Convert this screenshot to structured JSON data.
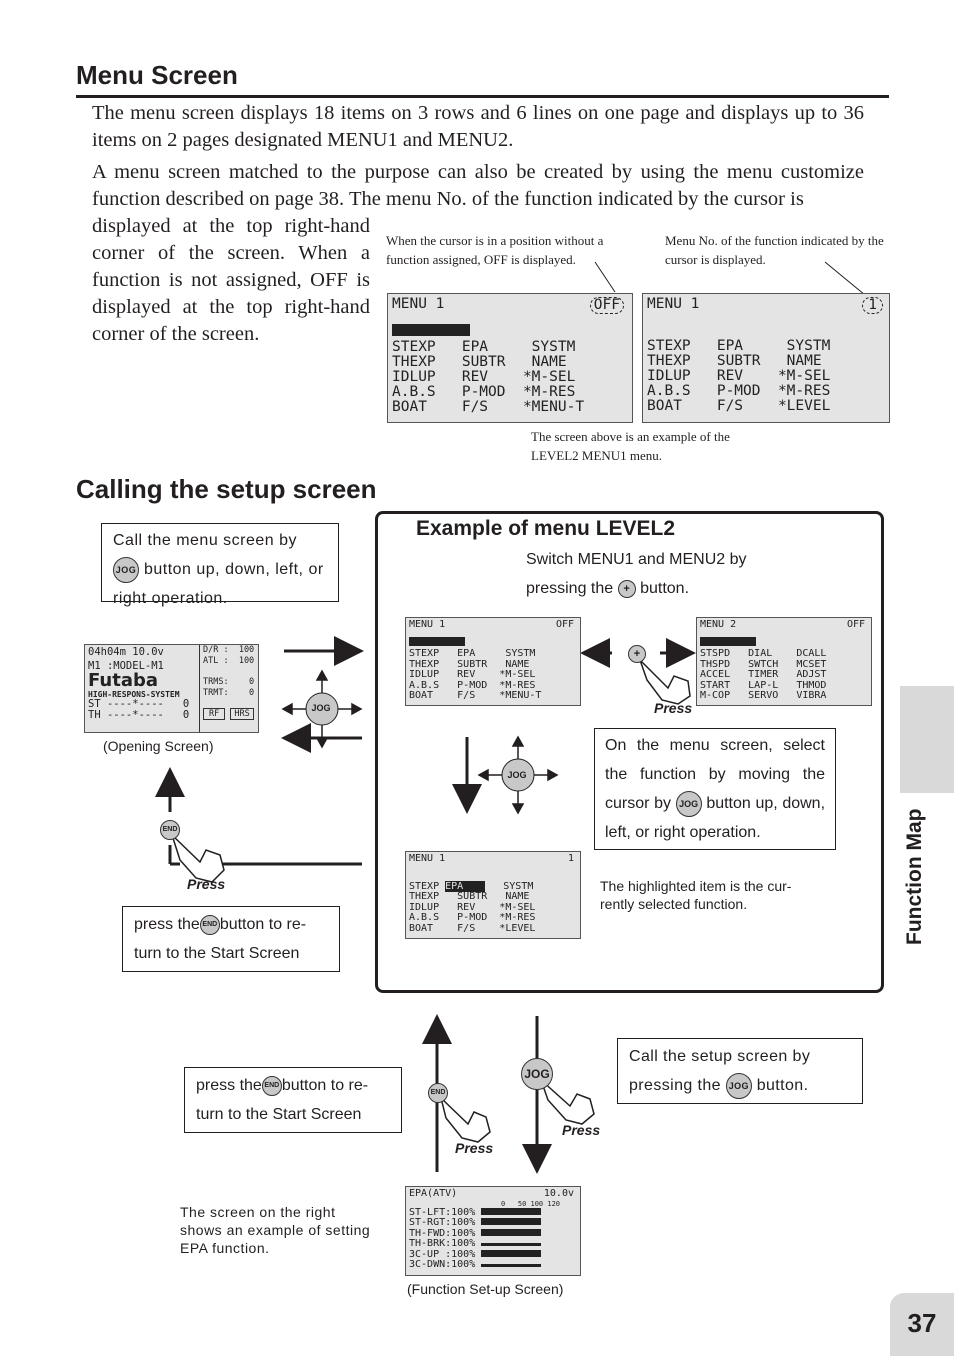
{
  "menu_screen": {
    "title": "Menu Screen",
    "para1": "The menu screen displays 18 items on 3 rows and 6 lines on one page and displays up to 36 items on 2 pages designated MENU1 and MENU2.",
    "para2": "A menu screen matched to the purpose can also be created by using the menu customize function described on page 38. The menu No. of the function indicated by the cursor is",
    "para2_cont": "displayed at the top right-hand corner of the screen. When a function is not assigned, OFF is displayed at the top right-hand corner of the screen.",
    "note_left": "When the cursor is in a position without a function assigned, OFF is displayed.",
    "note_right": "Menu No. of the function indicated by the cursor is displayed.",
    "caption": "The screen above is an example of the LEVEL2 MENU1 menu.",
    "lcd_off": {
      "title": "MENU 1",
      "corner": "OFF",
      "rows": [
        "STEXP   EPA     SYSTM",
        "THEXP   SUBTR   NAME",
        "IDLUP   REV    *M-SEL",
        "A.B.S   P-MOD  *M-RES",
        "BOAT    F/S    *MENU-T"
      ]
    },
    "lcd_num": {
      "title": "MENU 1",
      "corner": "1",
      "rows": [
        "STEXP   EPA     SYSTM",
        "THEXP   SUBTR   NAME",
        "IDLUP   REV    *M-SEL",
        "A.B.S   P-MOD  *M-RES",
        "BOAT    F/S    *LEVEL"
      ]
    }
  },
  "setup": {
    "title": "Calling the setup screen",
    "call_menu_pre": "Call the menu screen by",
    "call_menu_post": "button up, down, left, or right operation.",
    "opening_caption": "(Opening Screen)",
    "return1_pre": "press the",
    "return1_post": "button to re-turn to the Start Screen",
    "return2_pre": "press the",
    "return2_post": "button to re-turn to the Start Screen",
    "call_setup_pre": "Call the setup screen by pressing the",
    "call_setup_post": "button.",
    "epa_note": "The screen on the right shows an example of setting EPA function.",
    "function_caption": "(Function Set-up Screen)",
    "press": "Press",
    "jog": "JOG",
    "end": "END",
    "plus": "+"
  },
  "level2": {
    "title": "Example of menu LEVEL2",
    "switch_pre": "Switch MENU1 and MENU2 by",
    "switch_mid": "pressing the",
    "switch_post": "button.",
    "select_pre": "On the menu screen, select the function by moving the cursor by",
    "select_post": "button up, down, left, or right operation.",
    "highlight_note": "The highlighted item is the cur-rently selected function.",
    "lcd_menu1": {
      "title": "MENU 1",
      "corner": "OFF",
      "rows": [
        "STEXP   EPA     SYSTM",
        "THEXP   SUBTR   NAME",
        "IDLUP   REV    *M-SEL",
        "A.B.S   P-MOD  *M-RES",
        "BOAT    F/S    *MENU-T"
      ]
    },
    "lcd_menu2": {
      "title": "MENU 2",
      "corner": "OFF",
      "rows": [
        "STSPD   DIAL    DCALL",
        "THSPD   SWTCH   MCSET",
        "ACCEL   TIMER   ADJST",
        "START   LAP-L   THMOD",
        "M-COP   SERVO   VIBRA"
      ]
    },
    "lcd_sel": {
      "title": "MENU 1",
      "corner": "1",
      "rows": [
        "STEXP ",
        "THEXP   SUBTR   NAME",
        "IDLUP   REV    *M-SEL",
        "A.B.S   P-MOD  *M-RES",
        "BOAT    F/S    *LEVEL"
      ],
      "sel_item": "EPA",
      "row0_rest": "   SYSTM"
    }
  },
  "opening_lcd": {
    "rows": [
      "04h04m 10.0v",
      "M1 :MODEL-M1",
      "Futaba",
      "HIGH-RESPONS-SYSTEM",
      "ST ----*----   0",
      "TH ----*----   0"
    ],
    "right": [
      "D/R :  100",
      "ATL :  100",
      "TRMS:    0",
      "TRMT:    0"
    ],
    "btns": [
      "RF",
      "HRS"
    ]
  },
  "epa_lcd": {
    "title": "EPA(ATV)",
    "voltage": "10.0v",
    "scale": "0   50 100 120",
    "rows": [
      "ST-LFT:100%",
      "ST-RGT:100%",
      "TH-FWD:100%",
      "TH-BRK:100%",
      "3C-UP :100%",
      "3C-DWN:100%"
    ]
  },
  "side_tab": "Function Map",
  "page_number": "37"
}
